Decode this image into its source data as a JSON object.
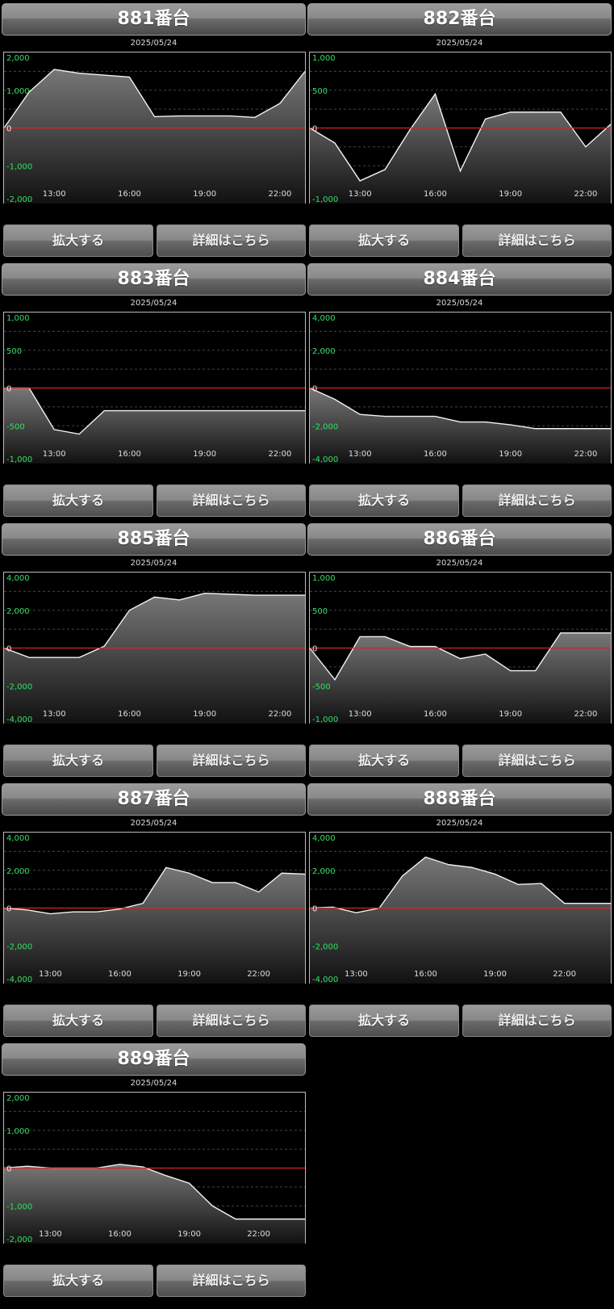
{
  "ui": {
    "zoom_label": "拡大する",
    "detail_label": "詳細はこちら"
  },
  "chart_data": [
    {
      "type": "area",
      "title": "881番台",
      "date": "2025/05/24",
      "x": [
        "11:00",
        "12:00",
        "13:00",
        "14:00",
        "15:00",
        "16:00",
        "17:00",
        "18:00",
        "19:00",
        "20:00",
        "21:00",
        "22:00",
        "23:00"
      ],
      "xticks": [
        "13:00",
        "16:00",
        "19:00",
        "22:00"
      ],
      "ylim": [
        -2000,
        2000
      ],
      "yticks": [
        2000,
        1000,
        0,
        -1000,
        -2000
      ],
      "ytick_labels": [
        "2,000",
        "1,000",
        "0",
        "-1,000",
        "-2,000"
      ],
      "values": [
        0,
        950,
        1550,
        1450,
        1400,
        1350,
        300,
        320,
        320,
        320,
        280,
        650,
        1500
      ]
    },
    {
      "type": "area",
      "title": "882番台",
      "date": "2025/05/24",
      "x": [
        "11:00",
        "12:00",
        "13:00",
        "14:00",
        "15:00",
        "16:00",
        "17:00",
        "18:00",
        "19:00",
        "20:00",
        "21:00",
        "22:00",
        "23:00"
      ],
      "xticks": [
        "13:00",
        "16:00",
        "19:00",
        "22:00"
      ],
      "ylim": [
        -1000,
        1000
      ],
      "yticks": [
        1000,
        500,
        0,
        -1000
      ],
      "ytick_labels": [
        "1,000",
        "500",
        "0",
        "-1,000"
      ],
      "values": [
        0,
        -200,
        -700,
        -550,
        -20,
        450,
        -570,
        120,
        210,
        210,
        210,
        -250,
        50
      ]
    },
    {
      "type": "area",
      "title": "883番台",
      "date": "2025/05/24",
      "x": [
        "11:00",
        "12:00",
        "13:00",
        "14:00",
        "15:00",
        "16:00",
        "17:00",
        "18:00",
        "19:00",
        "20:00",
        "21:00",
        "22:00",
        "23:00"
      ],
      "xticks": [
        "13:00",
        "16:00",
        "19:00",
        "22:00"
      ],
      "ylim": [
        -1000,
        1000
      ],
      "yticks": [
        1000,
        500,
        0,
        -500,
        -1000
      ],
      "ytick_labels": [
        "1,000",
        "500",
        "0",
        "-500",
        "-1,000"
      ],
      "values": [
        0,
        0,
        -550,
        -610,
        -300,
        -300,
        -300,
        -300,
        -300,
        -300,
        -300,
        -300,
        -300
      ]
    },
    {
      "type": "area",
      "title": "884番台",
      "date": "2025/05/24",
      "x": [
        "11:00",
        "12:00",
        "13:00",
        "14:00",
        "15:00",
        "16:00",
        "17:00",
        "18:00",
        "19:00",
        "20:00",
        "21:00",
        "22:00",
        "23:00"
      ],
      "xticks": [
        "13:00",
        "16:00",
        "19:00",
        "22:00"
      ],
      "ylim": [
        -4000,
        4000
      ],
      "yticks": [
        4000,
        2000,
        0,
        -2000,
        -4000
      ],
      "ytick_labels": [
        "4,000",
        "2,000",
        "0",
        "-2,000",
        "-4,000"
      ],
      "values": [
        0,
        -600,
        -1400,
        -1500,
        -1500,
        -1500,
        -1800,
        -1800,
        -1950,
        -2150,
        -2150,
        -2150,
        -2150
      ]
    },
    {
      "type": "area",
      "title": "885番台",
      "date": "2025/05/24",
      "x": [
        "11:00",
        "12:00",
        "13:00",
        "14:00",
        "15:00",
        "16:00",
        "17:00",
        "18:00",
        "19:00",
        "20:00",
        "21:00",
        "22:00",
        "23:00"
      ],
      "xticks": [
        "13:00",
        "16:00",
        "19:00",
        "22:00"
      ],
      "ylim": [
        -4000,
        4000
      ],
      "yticks": [
        4000,
        2000,
        0,
        -2000,
        -4000
      ],
      "ytick_labels": [
        "4,000",
        "2,000",
        "0",
        "-2,000",
        "-4,000"
      ],
      "values": [
        0,
        -500,
        -500,
        -500,
        100,
        2000,
        2700,
        2550,
        2900,
        2850,
        2800,
        2800,
        2800
      ]
    },
    {
      "type": "area",
      "title": "886番台",
      "date": "2025/05/24",
      "x": [
        "11:00",
        "12:00",
        "13:00",
        "14:00",
        "15:00",
        "16:00",
        "17:00",
        "18:00",
        "19:00",
        "20:00",
        "21:00",
        "22:00",
        "23:00"
      ],
      "xticks": [
        "13:00",
        "16:00",
        "19:00",
        "22:00"
      ],
      "ylim": [
        -1000,
        1000
      ],
      "yticks": [
        1000,
        500,
        0,
        -500,
        -1000
      ],
      "ytick_labels": [
        "1,000",
        "500",
        "0",
        "-500",
        "-1,000"
      ],
      "values": [
        0,
        -420,
        150,
        150,
        20,
        20,
        -140,
        -80,
        -300,
        -300,
        200,
        200,
        200
      ]
    },
    {
      "type": "area",
      "title": "887番台",
      "date": "2025/05/24",
      "x": [
        "11:00",
        "12:00",
        "13:00",
        "14:00",
        "15:00",
        "16:00",
        "17:00",
        "18:00",
        "19:00",
        "20:00",
        "21:00",
        "22:00",
        "23:00"
      ],
      "xticks": [
        "13:00",
        "16:00",
        "19:00",
        "22:00"
      ],
      "ylim": [
        -4000,
        4000
      ],
      "yticks": [
        4000,
        2000,
        0,
        -2000,
        -4000
      ],
      "ytick_labels": [
        "4,000",
        "2,000",
        "0",
        "-2,000",
        "-4,000"
      ],
      "values": [
        0,
        -100,
        -300,
        -200,
        -200,
        -50,
        250,
        2150,
        1850,
        1350,
        1350,
        850,
        1850,
        1800
      ]
    },
    {
      "type": "area",
      "title": "888番台",
      "date": "2025/05/24",
      "x": [
        "11:00",
        "12:00",
        "13:00",
        "14:00",
        "15:00",
        "16:00",
        "17:00",
        "18:00",
        "19:00",
        "20:00",
        "21:00",
        "22:00",
        "23:00"
      ],
      "xticks": [
        "13:00",
        "16:00",
        "19:00",
        "22:00"
      ],
      "ylim": [
        -4000,
        4000
      ],
      "yticks": [
        4000,
        2000,
        0,
        -2000,
        -4000
      ],
      "ytick_labels": [
        "4,000",
        "2,000",
        "0",
        "-2,000",
        "-4,000"
      ],
      "values": [
        0,
        50,
        -250,
        0,
        1700,
        2700,
        2300,
        2150,
        1800,
        1250,
        1300,
        250,
        250,
        250
      ]
    },
    {
      "type": "area",
      "title": "889番台",
      "date": "2025/05/24",
      "x": [
        "11:00",
        "12:00",
        "13:00",
        "14:00",
        "15:00",
        "16:00",
        "17:00",
        "18:00",
        "19:00",
        "20:00",
        "21:00",
        "22:00",
        "23:00"
      ],
      "xticks": [
        "13:00",
        "16:00",
        "19:00",
        "22:00"
      ],
      "ylim": [
        -2000,
        2000
      ],
      "yticks": [
        2000,
        1000,
        0,
        -1000,
        -2000
      ],
      "ytick_labels": [
        "2,000",
        "1,000",
        "0",
        "-1,000",
        "-2,000"
      ],
      "values": [
        0,
        50,
        0,
        0,
        0,
        100,
        30,
        -200,
        -400,
        -1000,
        -1350,
        -1350,
        -1350,
        -1350
      ]
    }
  ]
}
